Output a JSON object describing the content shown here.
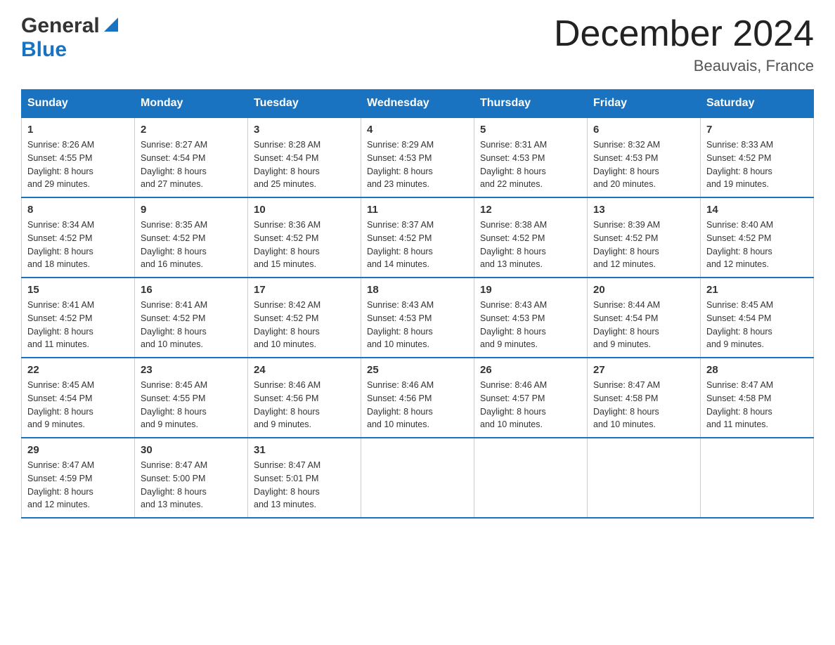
{
  "header": {
    "logo_general": "General",
    "logo_blue": "Blue",
    "month_year": "December 2024",
    "location": "Beauvais, France"
  },
  "days_of_week": [
    "Sunday",
    "Monday",
    "Tuesday",
    "Wednesday",
    "Thursday",
    "Friday",
    "Saturday"
  ],
  "weeks": [
    [
      {
        "day": "1",
        "sunrise": "8:26 AM",
        "sunset": "4:55 PM",
        "daylight": "8 hours and 29 minutes."
      },
      {
        "day": "2",
        "sunrise": "8:27 AM",
        "sunset": "4:54 PM",
        "daylight": "8 hours and 27 minutes."
      },
      {
        "day": "3",
        "sunrise": "8:28 AM",
        "sunset": "4:54 PM",
        "daylight": "8 hours and 25 minutes."
      },
      {
        "day": "4",
        "sunrise": "8:29 AM",
        "sunset": "4:53 PM",
        "daylight": "8 hours and 23 minutes."
      },
      {
        "day": "5",
        "sunrise": "8:31 AM",
        "sunset": "4:53 PM",
        "daylight": "8 hours and 22 minutes."
      },
      {
        "day": "6",
        "sunrise": "8:32 AM",
        "sunset": "4:53 PM",
        "daylight": "8 hours and 20 minutes."
      },
      {
        "day": "7",
        "sunrise": "8:33 AM",
        "sunset": "4:52 PM",
        "daylight": "8 hours and 19 minutes."
      }
    ],
    [
      {
        "day": "8",
        "sunrise": "8:34 AM",
        "sunset": "4:52 PM",
        "daylight": "8 hours and 18 minutes."
      },
      {
        "day": "9",
        "sunrise": "8:35 AM",
        "sunset": "4:52 PM",
        "daylight": "8 hours and 16 minutes."
      },
      {
        "day": "10",
        "sunrise": "8:36 AM",
        "sunset": "4:52 PM",
        "daylight": "8 hours and 15 minutes."
      },
      {
        "day": "11",
        "sunrise": "8:37 AM",
        "sunset": "4:52 PM",
        "daylight": "8 hours and 14 minutes."
      },
      {
        "day": "12",
        "sunrise": "8:38 AM",
        "sunset": "4:52 PM",
        "daylight": "8 hours and 13 minutes."
      },
      {
        "day": "13",
        "sunrise": "8:39 AM",
        "sunset": "4:52 PM",
        "daylight": "8 hours and 12 minutes."
      },
      {
        "day": "14",
        "sunrise": "8:40 AM",
        "sunset": "4:52 PM",
        "daylight": "8 hours and 12 minutes."
      }
    ],
    [
      {
        "day": "15",
        "sunrise": "8:41 AM",
        "sunset": "4:52 PM",
        "daylight": "8 hours and 11 minutes."
      },
      {
        "day": "16",
        "sunrise": "8:41 AM",
        "sunset": "4:52 PM",
        "daylight": "8 hours and 10 minutes."
      },
      {
        "day": "17",
        "sunrise": "8:42 AM",
        "sunset": "4:52 PM",
        "daylight": "8 hours and 10 minutes."
      },
      {
        "day": "18",
        "sunrise": "8:43 AM",
        "sunset": "4:53 PM",
        "daylight": "8 hours and 10 minutes."
      },
      {
        "day": "19",
        "sunrise": "8:43 AM",
        "sunset": "4:53 PM",
        "daylight": "8 hours and 9 minutes."
      },
      {
        "day": "20",
        "sunrise": "8:44 AM",
        "sunset": "4:54 PM",
        "daylight": "8 hours and 9 minutes."
      },
      {
        "day": "21",
        "sunrise": "8:45 AM",
        "sunset": "4:54 PM",
        "daylight": "8 hours and 9 minutes."
      }
    ],
    [
      {
        "day": "22",
        "sunrise": "8:45 AM",
        "sunset": "4:54 PM",
        "daylight": "8 hours and 9 minutes."
      },
      {
        "day": "23",
        "sunrise": "8:45 AM",
        "sunset": "4:55 PM",
        "daylight": "8 hours and 9 minutes."
      },
      {
        "day": "24",
        "sunrise": "8:46 AM",
        "sunset": "4:56 PM",
        "daylight": "8 hours and 9 minutes."
      },
      {
        "day": "25",
        "sunrise": "8:46 AM",
        "sunset": "4:56 PM",
        "daylight": "8 hours and 10 minutes."
      },
      {
        "day": "26",
        "sunrise": "8:46 AM",
        "sunset": "4:57 PM",
        "daylight": "8 hours and 10 minutes."
      },
      {
        "day": "27",
        "sunrise": "8:47 AM",
        "sunset": "4:58 PM",
        "daylight": "8 hours and 10 minutes."
      },
      {
        "day": "28",
        "sunrise": "8:47 AM",
        "sunset": "4:58 PM",
        "daylight": "8 hours and 11 minutes."
      }
    ],
    [
      {
        "day": "29",
        "sunrise": "8:47 AM",
        "sunset": "4:59 PM",
        "daylight": "8 hours and 12 minutes."
      },
      {
        "day": "30",
        "sunrise": "8:47 AM",
        "sunset": "5:00 PM",
        "daylight": "8 hours and 13 minutes."
      },
      {
        "day": "31",
        "sunrise": "8:47 AM",
        "sunset": "5:01 PM",
        "daylight": "8 hours and 13 minutes."
      },
      null,
      null,
      null,
      null
    ]
  ],
  "labels": {
    "sunrise": "Sunrise:",
    "sunset": "Sunset:",
    "daylight": "Daylight:"
  }
}
